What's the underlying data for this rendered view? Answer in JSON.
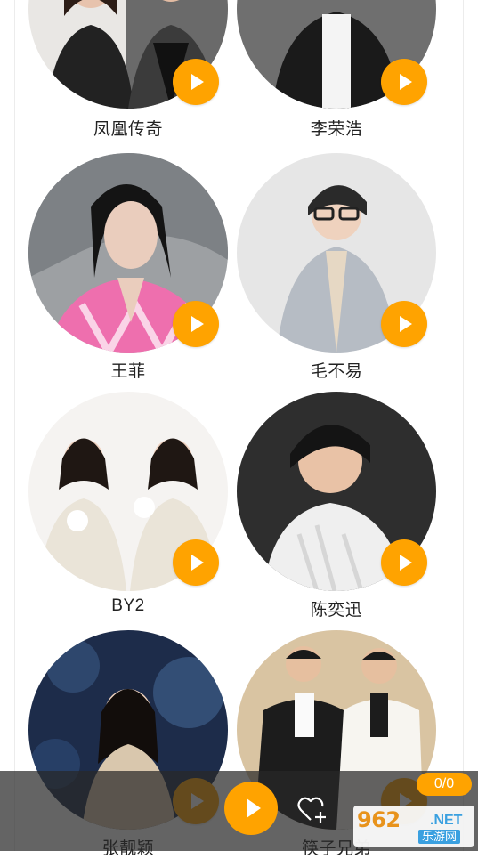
{
  "artists": [
    {
      "name": "凤凰传奇",
      "photo": "duo-portrait"
    },
    {
      "name": "李荣浩",
      "photo": "male-portrait"
    },
    {
      "name": "王菲",
      "photo": "female-portrait"
    },
    {
      "name": "毛不易",
      "photo": "male-portrait-glasses"
    },
    {
      "name": "BY2",
      "photo": "duo-portrait"
    },
    {
      "name": "陈奕迅",
      "photo": "male-portrait"
    },
    {
      "name": "张靓颖",
      "photo": "female-portrait"
    },
    {
      "name": "筷子兄弟",
      "photo": "duo-portrait"
    }
  ],
  "player": {
    "counter": "0/0",
    "play_icon": "play-icon",
    "favorite_icon": "heart-plus-icon"
  },
  "watermark": {
    "main": "962",
    "suffix": ".NET",
    "sub": "乐游网"
  },
  "colors": {
    "accent": "#ffa300",
    "player_bg": "#282828"
  }
}
